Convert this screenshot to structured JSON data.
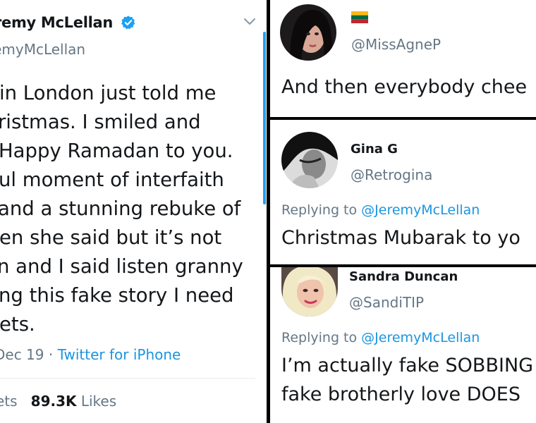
{
  "left_tweet": {
    "name": "eremy McLellan",
    "handle": "eremyMcLellan",
    "lines": [
      "in London just told me",
      "ristmas. I smiled and",
      "Happy Ramadan to you.",
      "ul moment of interfaith",
      "and a stunning rebuke of",
      "en she said but it’s not",
      "n and I said listen granny",
      "ng this fake story I need",
      "ets."
    ],
    "date": "Dec 19 · ",
    "source": "Twitter for iPhone",
    "retweets_label": "ets",
    "likes_count": "89.3K",
    "likes_label": "Likes"
  },
  "reply1": {
    "handle": "@MissAgneP",
    "text": "And then everybody chee"
  },
  "reply2": {
    "name": "Gina G",
    "handle": "@Retrogina",
    "replying_to": "Replying to ",
    "mention": "@JeremyMcLellan",
    "text": "Christmas Mubarak to yo"
  },
  "reply3": {
    "name": "Sandra Duncan",
    "handle": "@SandiTIP",
    "replying_to": "Replying to ",
    "mention": "@JeremyMcLellan",
    "text_line1": "I’m actually fake SOBBING",
    "text_line2": "fake brotherly love DOES"
  },
  "colors": {
    "twitter_blue": "#1da1f2",
    "link_blue": "#1b95e0",
    "secondary_text": "#657786",
    "primary_text": "#14171a"
  },
  "icons": {
    "verified": "verified-badge-icon",
    "caret": "chevron-down-icon",
    "flag": "lithuania-flag-icon"
  }
}
